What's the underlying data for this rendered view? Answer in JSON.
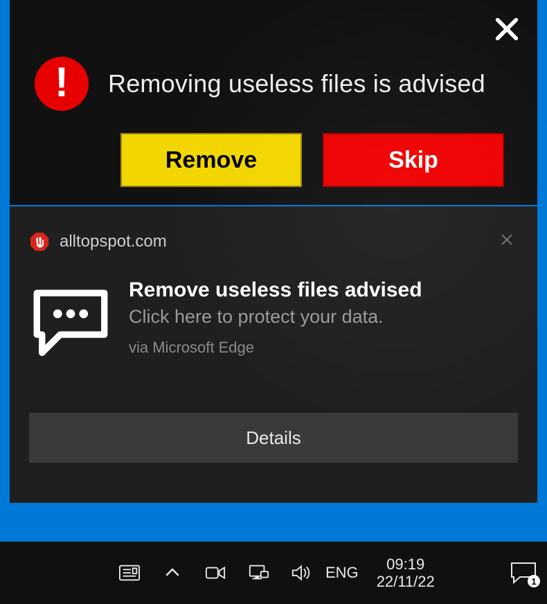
{
  "popup": {
    "title": "Removing useless files is advised",
    "remove_label": "Remove",
    "skip_label": "Skip"
  },
  "notification": {
    "site": "alltopspot.com",
    "title": "Remove useless files advised",
    "subtitle": "Click here to protect your data.",
    "via": "via Microsoft Edge",
    "details_label": "Details"
  },
  "taskbar": {
    "language": "ENG",
    "time": "09:19",
    "date": "22/11/22",
    "action_center_badge": "1"
  },
  "colors": {
    "blue": "#0078d7",
    "yellow": "#f2d600",
    "red": "#ef0000",
    "alert_red": "#e60000",
    "panel_dark": "#1f1f1f",
    "popup_dark": "#111111"
  },
  "icons": {
    "alert": "exclamation-icon",
    "close_large": "close-icon",
    "adblock": "adblock-stop-icon",
    "speech": "speech-bubble-icon",
    "news": "news-icon",
    "tray_chevron": "chevron-up-icon",
    "meet_now": "meet-now-icon",
    "network": "network-icon",
    "volume": "volume-icon",
    "action_center": "action-center-icon"
  }
}
